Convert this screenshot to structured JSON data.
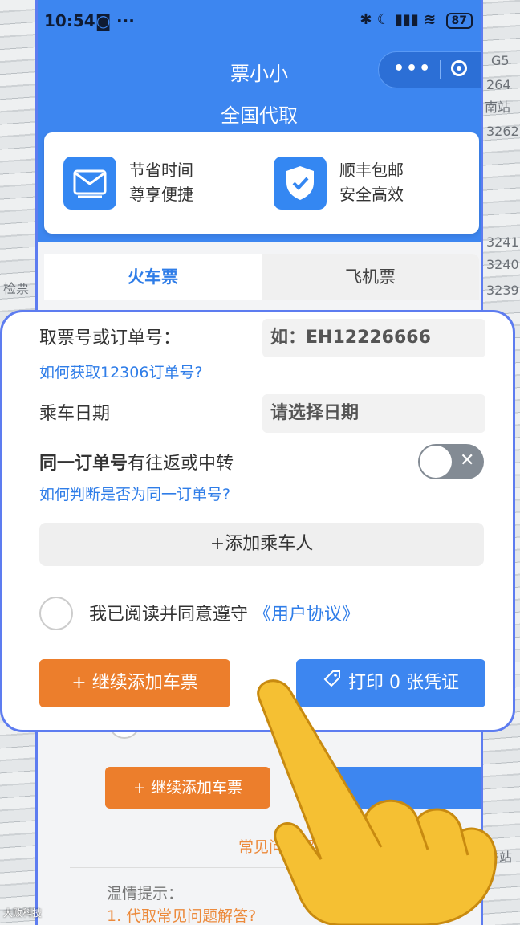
{
  "status_bar": {
    "time": "10:54",
    "dots": "···",
    "battery": "87"
  },
  "header": {
    "app_title": "票小小",
    "subtitle": "全国代取"
  },
  "features": [
    {
      "icon": "mail-icon",
      "line1": "节省时间",
      "line2": "尊享便捷"
    },
    {
      "icon": "shield-check-icon",
      "line1": "顺丰包邮",
      "line2": "安全高效"
    }
  ],
  "tabs": [
    {
      "label": "火车票",
      "active": true
    },
    {
      "label": "飞机票",
      "active": false
    }
  ],
  "form": {
    "ticket_label": "取票号或订单号：",
    "ticket_placeholder": "如：EH12226666",
    "how_get_link": "如何获取12306订单号?",
    "date_label": "乘车日期",
    "date_placeholder": "请选择日期",
    "same_order_label_bold": "同一订单号",
    "same_order_label_rest": "有往返或中转",
    "same_order_link": "如何判断是否为同一订单号?",
    "add_passenger": "+添加乘车人",
    "agree_text": "我已阅读并同意遵守",
    "agree_link": "《用户协议》",
    "continue_button": "+ 继续添加车票",
    "print_button": "打印 0 张凭证"
  },
  "lower": {
    "continue_button": "+ 继续添加车票",
    "faq": "常见问题解",
    "tips_title": "温情提示：",
    "tips_item": "1. 代取常见问题解答?"
  },
  "background_text": [
    "G5",
    "264",
    "南站",
    "3262",
    "3241",
    "3240",
    "3239",
    "检票",
    "进站"
  ],
  "watermark": "大败科技",
  "colors": {
    "primary": "#3d86f0",
    "orange": "#ec7e2c",
    "link": "#2f7de8"
  }
}
